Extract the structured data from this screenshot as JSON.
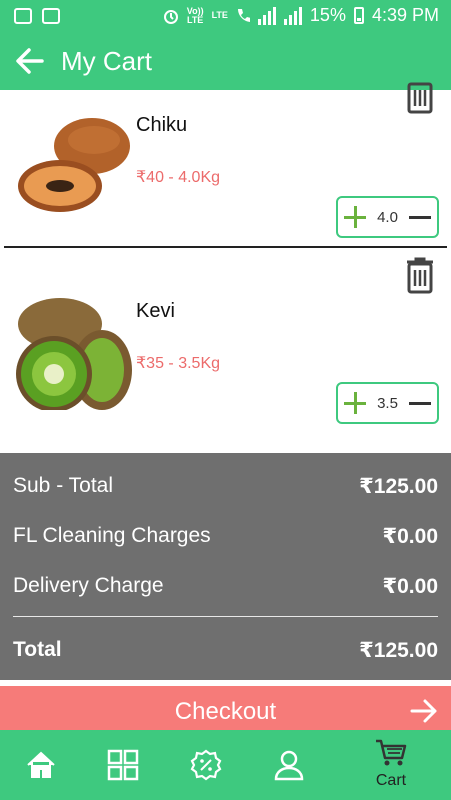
{
  "status_bar": {
    "volte_line1": "Vo))",
    "volte_line2": "LTE",
    "lte_label": "LTE",
    "battery_percent": "15%",
    "time": "4:39 PM"
  },
  "app_bar": {
    "title": "My Cart"
  },
  "cart": {
    "items": [
      {
        "name": "Chiku",
        "price_line": "₹40 - 4.0Kg",
        "quantity": "4.0",
        "image_icon": "sapodilla-image"
      },
      {
        "name": "Kevi",
        "price_line": "₹35 - 3.5Kg",
        "quantity": "3.5",
        "image_icon": "kiwi-image"
      }
    ]
  },
  "summary": {
    "subtotal_label": "Sub - Total",
    "subtotal_value": "₹125.00",
    "cleaning_label": "FL Cleaning Charges",
    "cleaning_value": "₹0.00",
    "delivery_label": "Delivery Charge",
    "delivery_value": "₹0.00",
    "total_label": "Total",
    "total_value": "₹125.00"
  },
  "checkout": {
    "label": "Checkout"
  },
  "bottom_nav": {
    "cart_label": "Cart"
  },
  "colors": {
    "primary": "#3ec97f",
    "checkout": "#f67b79",
    "price": "#ec6b6b",
    "summary_bg": "#6f6f6f"
  }
}
